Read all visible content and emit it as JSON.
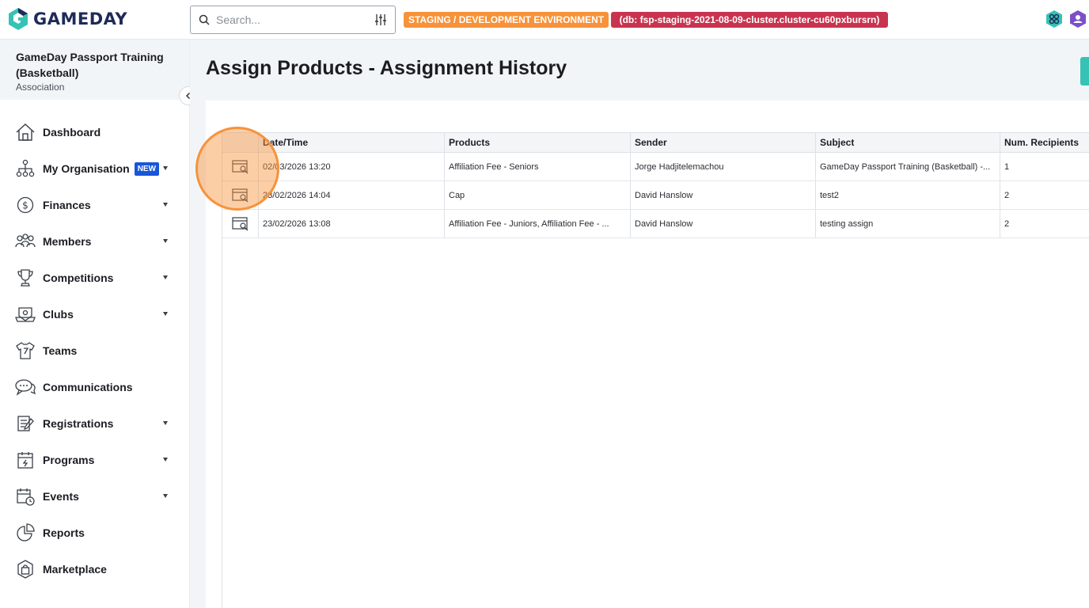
{
  "app": {
    "logo_text": "GAMEDAY",
    "colors": {
      "brand_navy": "#1e2b57",
      "brand_teal": "#36c2b4",
      "env_staging": "#f7923a",
      "env_db": "#c8344f",
      "new_badge": "#1856d9"
    }
  },
  "topbar": {
    "search_placeholder": "Search...",
    "search_icon": "search-icon",
    "filter_icon": "sliders-icon",
    "env_label": "STAGING / DEVELOPMENT ENVIRONMENT",
    "db_label": "(db: fsp-staging-2021-08-09-cluster.cluster-cu60pxbursrn)"
  },
  "sidebar": {
    "org_name": "GameDay Passport Training (Basketball)",
    "org_type": "Association",
    "items": [
      {
        "label": "Dashboard",
        "icon": "home-icon",
        "caret": false
      },
      {
        "label": "My Organisation",
        "icon": "org-chart-icon",
        "badge": "NEW",
        "caret": true
      },
      {
        "label": "Finances",
        "icon": "dollar-icon",
        "caret": true
      },
      {
        "label": "Members",
        "icon": "people-icon",
        "caret": true
      },
      {
        "label": "Competitions",
        "icon": "trophy-icon",
        "caret": true
      },
      {
        "label": "Clubs",
        "icon": "club-icon",
        "caret": true
      },
      {
        "label": "Teams",
        "icon": "jersey-icon",
        "caret": false
      },
      {
        "label": "Communications",
        "icon": "chat-icon",
        "caret": false
      },
      {
        "label": "Registrations",
        "icon": "form-icon",
        "caret": true
      },
      {
        "label": "Programs",
        "icon": "calendar-icon",
        "caret": true
      },
      {
        "label": "Events",
        "icon": "event-icon",
        "caret": true
      },
      {
        "label": "Reports",
        "icon": "pie-chart-icon",
        "caret": false
      },
      {
        "label": "Marketplace",
        "icon": "bag-icon",
        "caret": false
      }
    ]
  },
  "main": {
    "title": "Assign Products - Assignment History",
    "table": {
      "headers": [
        "",
        "Date/Time",
        "Products",
        "Sender",
        "Subject",
        "Num. Recipients"
      ],
      "rows": [
        {
          "datetime": "02/03/2026 13:20",
          "products": "Affiliation Fee - Seniors",
          "sender": "Jorge Hadjitelemachou",
          "subject": "GameDay Passport Training (Basketball) -...",
          "recipients": "1"
        },
        {
          "datetime": "23/02/2026 14:04",
          "products": "Cap",
          "sender": "David Hanslow",
          "subject": "test2",
          "recipients": "2"
        },
        {
          "datetime": "23/02/2026 13:08",
          "products": "Affiliation Fee - Juniors, Affiliation Fee - ...",
          "sender": "David Hanslow",
          "subject": "testing assign",
          "recipients": "2"
        }
      ]
    }
  }
}
